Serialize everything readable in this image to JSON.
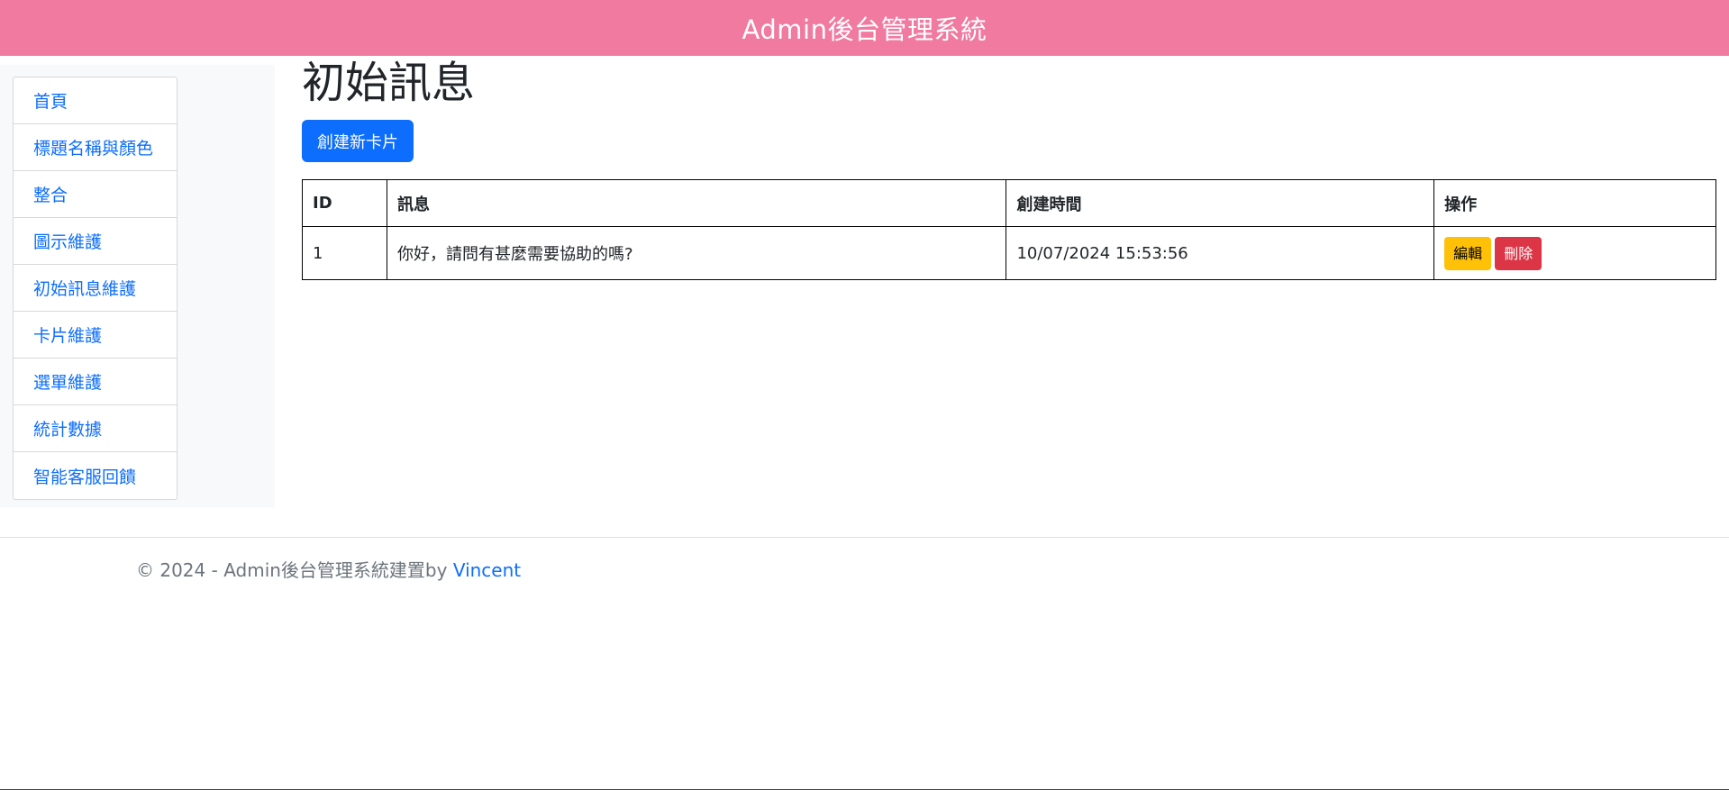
{
  "header": {
    "title": "Admin後台管理系統"
  },
  "sidebar": {
    "items": [
      {
        "label": "首頁"
      },
      {
        "label": "標題名稱與顏色"
      },
      {
        "label": "整合"
      },
      {
        "label": "圖示維護"
      },
      {
        "label": "初始訊息維護"
      },
      {
        "label": "卡片維護"
      },
      {
        "label": "選單維護"
      },
      {
        "label": "統計數據"
      },
      {
        "label": "智能客服回饋"
      }
    ]
  },
  "main": {
    "page_title": "初始訊息",
    "create_button_label": "創建新卡片",
    "table": {
      "headers": [
        "ID",
        "訊息",
        "創建時間",
        "操作"
      ],
      "rows": [
        {
          "id": "1",
          "message": "你好，請問有甚麼需要協助的嗎?",
          "created_at": "10/07/2024 15:53:56",
          "edit_label": "編輯",
          "delete_label": "刪除"
        }
      ]
    }
  },
  "footer": {
    "text": "© 2024 - Admin後台管理系統建置by",
    "link_text": "Vincent"
  },
  "colors": {
    "header_bg": "#f07aa0",
    "primary": "#0d6efd",
    "warning": "#ffc107",
    "danger": "#dc3545",
    "sidebar_bg": "#f8f9fa"
  }
}
